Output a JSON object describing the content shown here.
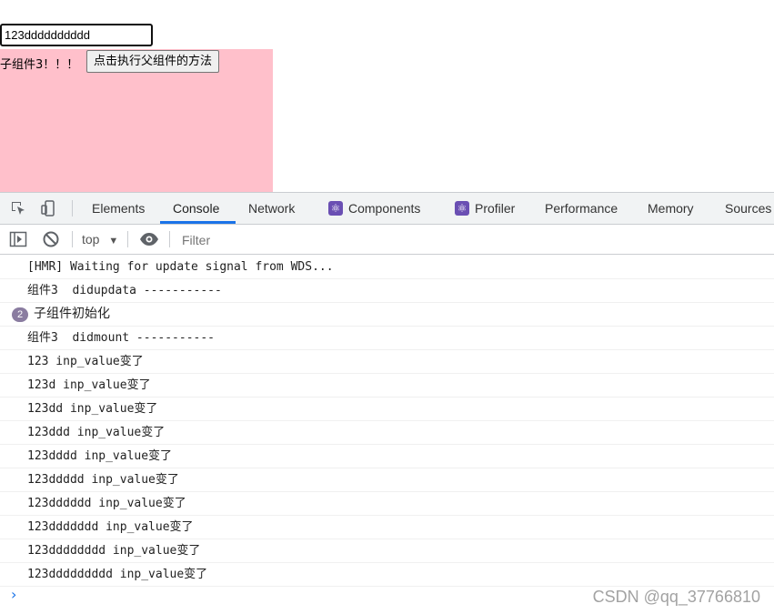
{
  "page": {
    "input_value": "123dddddddddd",
    "child_label": "子组件3！！！",
    "child_button_label": "点击执行父组件的方法"
  },
  "devtools": {
    "tabs": [
      "Elements",
      "Console",
      "Network",
      "Components",
      "Profiler",
      "Performance",
      "Memory",
      "Sources"
    ],
    "active_tab": "Console",
    "context": "top",
    "filter_placeholder": "Filter",
    "accent_color": "#1a73e8"
  },
  "console": {
    "messages": [
      {
        "text": "[HMR] Waiting for update signal from WDS..."
      },
      {
        "text": "组件3  didupdata -----------"
      },
      {
        "text": "子组件初始化",
        "count": "2"
      },
      {
        "text": "组件3  didmount -----------"
      },
      {
        "text": "123 inp_value变了"
      },
      {
        "text": "123d inp_value变了"
      },
      {
        "text": "123dd inp_value变了"
      },
      {
        "text": "123ddd inp_value变了"
      },
      {
        "text": "123dddd inp_value变了"
      },
      {
        "text": "123ddddd inp_value变了"
      },
      {
        "text": "123dddddd inp_value变了"
      },
      {
        "text": "123ddddddd inp_value变了"
      },
      {
        "text": "123dddddddd inp_value变了"
      },
      {
        "text": "123ddddddddd inp_value变了"
      }
    ]
  },
  "watermark": "CSDN @qq_37766810"
}
